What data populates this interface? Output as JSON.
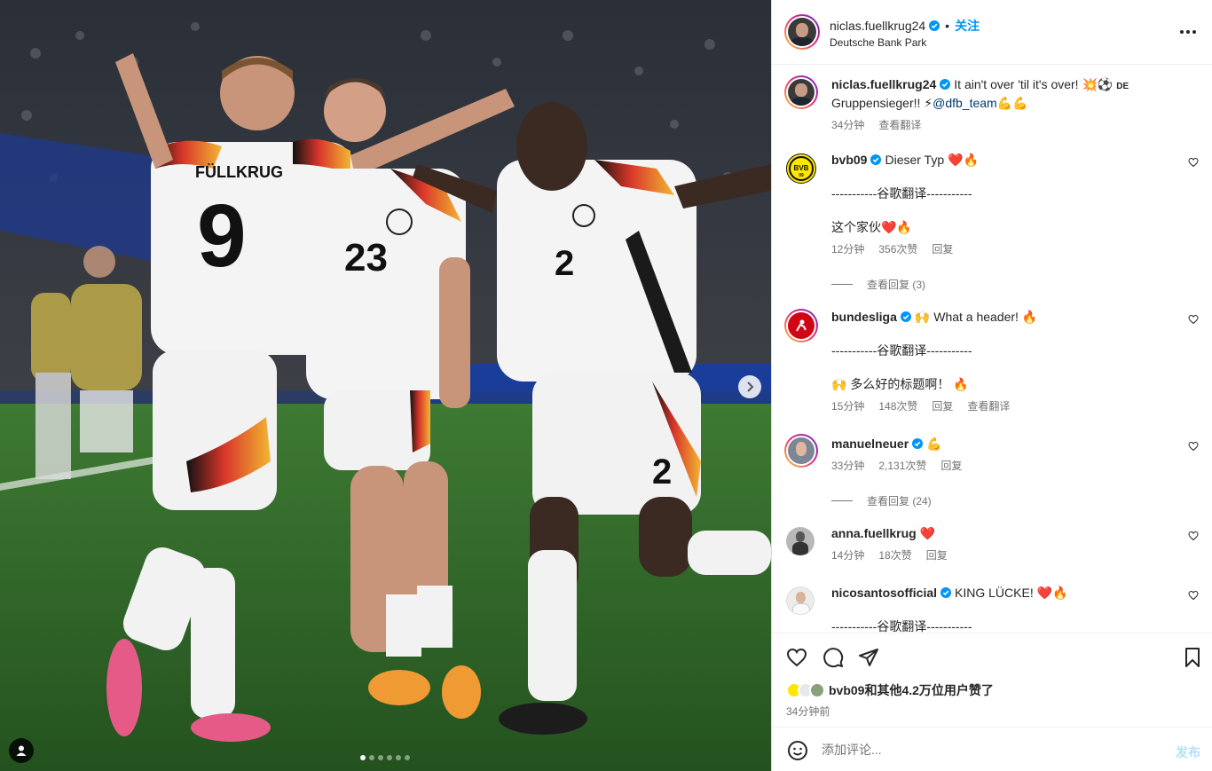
{
  "post": {
    "media": {
      "alt": "",
      "carousel_count": 6,
      "carousel_active": 0
    },
    "header": {
      "username": "niclas.fuellkrug24",
      "separator": "•",
      "follow_label": "关注",
      "location": "Deutsche Bank Park"
    },
    "caption": {
      "username": "niclas.fuellkrug24",
      "text": "It ain't over 'til it's over! 💥⚽",
      "flag": "DE",
      "text2": "Gruppensieger!! ⚡",
      "mention": "@dfb_team",
      "emoji_end": "💪💪",
      "time": "34分钟",
      "translate": "查看翻译"
    },
    "comments": [
      {
        "username": "bvb09",
        "text": "Dieser Typ ❤️🔥",
        "translation_divider": "-----------谷歌翻译-----------",
        "translation": "这个家伙❤️🔥",
        "time": "12分钟",
        "likes": "356次赞",
        "reply": "回复",
        "view_replies": "查看回复 (3)"
      },
      {
        "username": "bundesliga",
        "text": "🙌 What a header! 🔥",
        "translation_divider": "-----------谷歌翻译-----------",
        "translation": "🙌 多么好的标题啊！ 🔥",
        "time": "15分钟",
        "likes": "148次赞",
        "reply": "回复",
        "translate": "查看翻译"
      },
      {
        "username": "manuelneuer",
        "text": "💪",
        "time": "33分钟",
        "likes": "2,131次赞",
        "reply": "回复",
        "view_replies": "查看回复 (24)"
      },
      {
        "username": "anna.fuellkrug",
        "text": "❤️",
        "time": "14分钟",
        "likes": "18次赞",
        "reply": "回复"
      },
      {
        "username": "nicosantosofficial",
        "text": "KING LÜCKE! ❤️🔥",
        "translation_divider": "-----------谷歌翻译-----------"
      }
    ],
    "likes_text": "bvb09和其他4.2万位用户赞了",
    "time_ago": "34分钟前",
    "add_comment_placeholder": "添加评论...",
    "post_label": "发布"
  },
  "colors": {
    "accent": "#0095f6",
    "text": "#262626",
    "secondary": "#737373",
    "verified": "#0095f6",
    "pitch": "#2f6b2a"
  },
  "icons": {
    "like": "heart-icon",
    "comment": "comment-bubble-icon",
    "share": "paper-plane-icon",
    "save": "bookmark-icon",
    "emoji": "smiley-icon",
    "more": "more-dots-icon",
    "next": "chevron-right-icon",
    "tag": "user-tag-icon"
  }
}
